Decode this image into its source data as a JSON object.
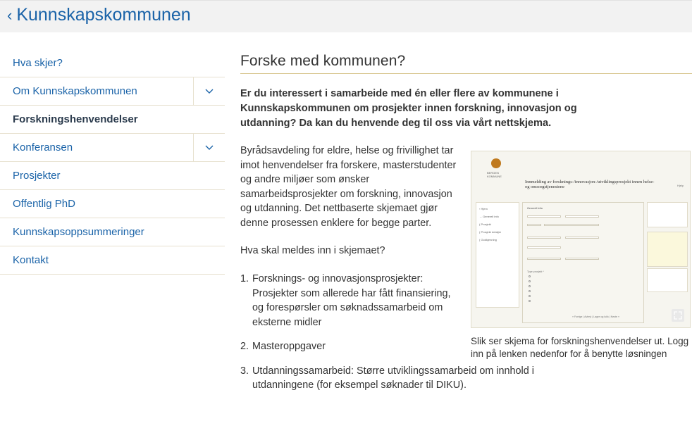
{
  "back_link": {
    "label": "Kunnskapskommunen"
  },
  "sidebar": {
    "items": [
      {
        "label": "Hva skjer?",
        "has_toggle": false,
        "active": false
      },
      {
        "label": "Om Kunnskapskommunen",
        "has_toggle": true,
        "active": false
      },
      {
        "label": "Forskningshenvendelser",
        "has_toggle": false,
        "active": true
      },
      {
        "label": "Konferansen",
        "has_toggle": true,
        "active": false
      },
      {
        "label": "Prosjekter",
        "has_toggle": false,
        "active": false
      },
      {
        "label": "Offentlig PhD",
        "has_toggle": false,
        "active": false
      },
      {
        "label": "Kunnskapsoppsummeringer",
        "has_toggle": false,
        "active": false
      },
      {
        "label": "Kontakt",
        "has_toggle": false,
        "active": false
      }
    ]
  },
  "main": {
    "title": "Forske med kommunen?",
    "lead": "Er du interessert i samarbeide med én eller flere av kommunene i Kunnskapskommunen om prosjekter innen forskning, innovasjon og utdanning? Da kan du henvende deg til oss via vårt nettskjema.",
    "body": "Byrådsavdeling for eldre, helse og frivillighet tar imot henvendelser fra forskere, masterstudenter og andre miljøer som ønsker samarbeidsprosjekter om forskning, innovasjon og utdanning. Det nettbaserte skjemaet gjør denne prosessen enklere for begge parter.",
    "question": "Hva skal meldes inn i skjemaet?",
    "list": [
      {
        "num": "1.",
        "text": "Forsknings- og innovasjonsprosjekter: Prosjekter som allerede har fått finansiering, og forespørsler om søknadssamarbeid om eksterne midler"
      },
      {
        "num": "2.",
        "text": "Masteroppgaver"
      },
      {
        "num": "3.",
        "text": "Utdanningssamarbeid: Større utviklingssamarbeid om innhold i utdanningene (for eksempel søknader til DIKU)."
      }
    ],
    "figure": {
      "caption": "Slik ser skjema for forskningshenvendelser ut. Logg inn på lenken nedenfor for å benytte løsningen",
      "mock_title": "Innmelding av forsknings-/innovasjon-/utviklingsprosjekt innen helse- og omsorgstjenestene"
    }
  },
  "colors": {
    "link": "#1a63a8",
    "active_nav": "#2b3b4d",
    "divider": "#e7e1cf",
    "title_rule": "#d8c68f",
    "topbar": "#f2f2f2"
  }
}
